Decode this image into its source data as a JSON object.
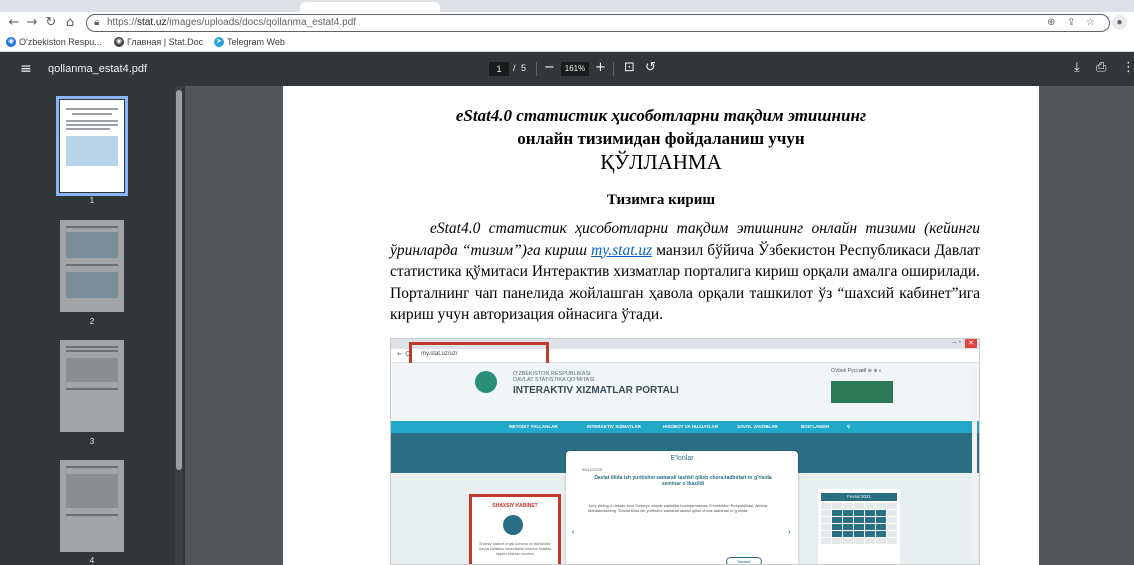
{
  "browser": {
    "url_prefix": "https://",
    "url_host": "stat.uz",
    "url_path": "/images/uploads/docs/qollanma_estat4.pdf",
    "bookmarks": [
      {
        "label": "O'zbekiston Respu...",
        "color": "#1a73e8"
      },
      {
        "label": "Главная | Stat.Doc",
        "color": "#444444"
      },
      {
        "label": "Telegram Web",
        "color": "#2aa1da"
      }
    ]
  },
  "viewer": {
    "file_title": "qollanma_estat4.pdf",
    "current_page": "1",
    "page_sep": "/",
    "total_pages": "5",
    "zoom": "161%"
  },
  "thumbnails": [
    {
      "number": "1",
      "active": true
    },
    {
      "number": "2",
      "active": false
    },
    {
      "number": "3",
      "active": false
    },
    {
      "number": "4",
      "active": false
    }
  ],
  "document": {
    "title_line1": "eStat4.0 статистик ҳисоботларни тақдим этишнинг",
    "title_line2": "онлайн тизимидан фойдаланиш учун",
    "title_line3": "ҚЎЛЛАНМА",
    "section_heading": "Тизимга кириш",
    "para_italic": "eStat4.0 статистик ҳисоботларни тақдим этишнинг онлайн тизими (кейинги ўринларда “тизим”)га кириш",
    "para_link": "my.stat.uz",
    "para_rest": " манзил бўйича Ўзбекистон Республикаси Давлат статистика қўмитаси Интерактив хизматлар порталига кириш орқали амалга оширилади. Порталнинг чап панелида жойлашган ҳавола орқали ташкилот ўз “шахсий кабинет”ига кириш учун авторизация ойнасига ўтади."
  },
  "screenshot": {
    "address": "my.stat.uz/uz/",
    "org_line1": "O'ZBEKISTON RESPUBLIKASI",
    "org_line2": "DAVLAT STATISTIKA QO'MITASI",
    "portal": "INTERAKTIV XIZMATLAR PORTALI",
    "nav": [
      "METODIY YALLANLAR",
      "INTERAKTIV XIZMATLAR",
      "HISOBOT VA HUJJATLAR",
      "SAVOL JAVOBLAR",
      "BOG'LANISH"
    ],
    "announcements": "E'lonlar",
    "ann_date": "09/12/2020",
    "ann_title": "Davlat tilida ish yuritishni samarali tashkil qilish chora-tadbirlari to`g'risida seminar o`tkazildi",
    "ann_text": "Joriy yilning 4 dekabr kuni Sirdaryo viloyat statistika boshqarmasida O'zbekiston Respublikasi Vazirlar Mahkamasining \"Davlat tilida ish yuritishni samarali tashkil qilish chora-tadbirlari to`g'risida",
    "ann_button": "Batafsil",
    "cabinet": "SHAXSIY KABINET",
    "cabinet_text": "Shaxsiy kabinet orqali korxona va tashkilotlar Davlat statistika hisobotlarini elektron shaklda taqdim etishlari mumkin",
    "calendar": "Fevral 2021"
  }
}
